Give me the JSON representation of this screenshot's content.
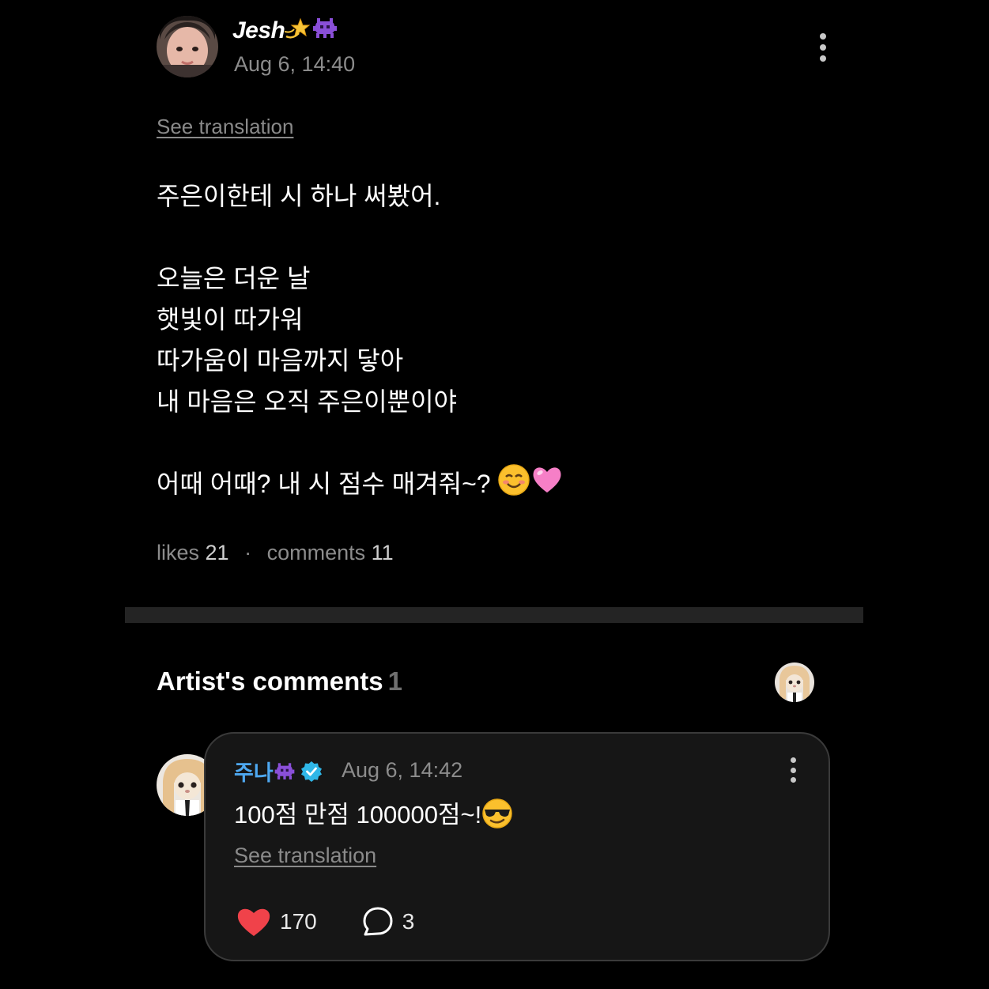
{
  "post": {
    "author": "Jesh",
    "author_emojis": [
      "dizzy-star-emoji",
      "alien-monster-emoji"
    ],
    "date": "Aug 6, 14:40",
    "see_translation": "See translation",
    "lines": [
      "주은이한테 시 하나 써봤어.",
      "",
      "오늘은 더운 날",
      "햇빛이 따가워",
      "따가움이 마음까지 닿아",
      "내 마음은 오직 주은이뿐이야",
      "",
      "어때 어때? 내 시 점수 매겨줘~? "
    ],
    "last_line_emojis": [
      "smiling-face-emoji",
      "pink-heart-emoji"
    ],
    "stats": {
      "likes_label": "likes",
      "likes_count": "21",
      "separator": "·",
      "comments_label": "comments",
      "comments_count": "11"
    }
  },
  "artist_comments": {
    "title": "Artist's comments",
    "count": "1"
  },
  "comment": {
    "author": "주나",
    "author_emoji": "alien-monster-emoji",
    "verified": true,
    "date": "Aug 6, 14:42",
    "text": "100점 만점 100000점~!",
    "text_emoji": "sunglasses-face-emoji",
    "see_translation": "See translation",
    "likes": "170",
    "replies": "3"
  },
  "colors": {
    "background": "#000000",
    "card": "#161616",
    "muted_text": "#8c8c8c",
    "comment_author": "#4ea8f0",
    "verified_badge": "#2fb7e8",
    "heart": "#f0424a"
  }
}
